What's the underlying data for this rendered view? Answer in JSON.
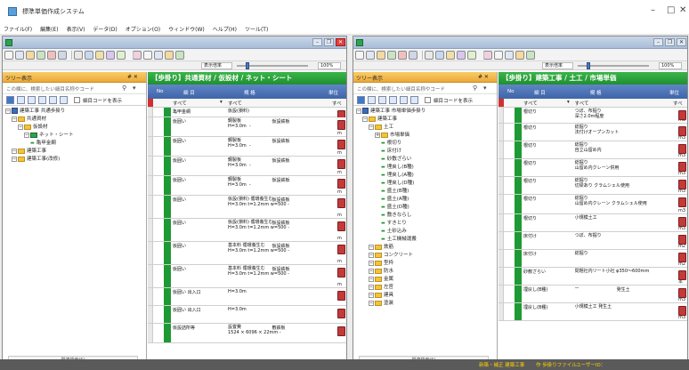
{
  "app": {
    "title": "標準単価作成システム"
  },
  "menu": [
    "ファイル(F)",
    "編集(E)",
    "表示(V)",
    "データ(D)",
    "オプション(O)",
    "ウィンドウ(W)",
    "ヘルプ(H)",
    "ツール(T)"
  ],
  "window_controls": {
    "minimize": "–",
    "maximize": "□",
    "close": "✕"
  },
  "panels": [
    {
      "zoom_label": "表示倍率",
      "zoom_value": "100%",
      "zoom_level_fraction": 0.6,
      "tree_title": "ツリー表示",
      "tree_ctl": "# ✕",
      "search_placeholder": "この欄に、検索したい細目名称やコード",
      "opt_label": "細目コードを表示",
      "tree": [
        {
          "level": 0,
          "label": "建築工事 共通歩掛り",
          "kind": "root"
        },
        {
          "level": 1,
          "label": "共通資材",
          "kind": "folder"
        },
        {
          "level": 2,
          "label": "仮設材",
          "kind": "folder"
        },
        {
          "level": 3,
          "label": "ネット・シート",
          "kind": "group"
        },
        {
          "level": 4,
          "label": "亀甲金網",
          "kind": "leaf"
        },
        {
          "level": 1,
          "label": "建築工事",
          "kind": "folder"
        },
        {
          "level": 1,
          "label": "建築工事(改修)",
          "kind": "folder"
        }
      ],
      "footer_label": "関連検索(S)",
      "header": "【歩掛り】共通資材 / 仮設材 / ネット・シート",
      "columns": {
        "no": "No",
        "name": "細 目",
        "spec": "規 格",
        "unit": "単位"
      },
      "filter": {
        "name": "すべて",
        "spec": "すべて",
        "unit": "すべ"
      },
      "rows": [
        {
          "name": "亀甲金網",
          "spec": "仮設(損料)",
          "spec2": "",
          "unit": ""
        },
        {
          "name": "仮囲い",
          "spec": "鋼製板",
          "spec2": "H=3.0m  -",
          "spec3": "仮設鉄板",
          "unit": "m"
        },
        {
          "name": "仮囲い",
          "spec": "鋼製板",
          "spec2": "H=3.0m  -",
          "spec3": "仮設鉄板",
          "unit": "m"
        },
        {
          "name": "仮囲い",
          "spec": "鋼製板",
          "spec2": "H=3.0m  -",
          "spec3": "仮設鉄板",
          "unit": "m"
        },
        {
          "name": "仮囲い",
          "spec": "鋼製板",
          "spec2": "H=3.0m  -",
          "spec3": "仮設鉄板",
          "unit": "m"
        },
        {
          "name": "仮囲い",
          "spec": "仮設(損料) 循環養生む",
          "spec2": "H=3.0m t=1.2mm w=500 -",
          "spec3": "仮設鉄板",
          "unit": "m"
        },
        {
          "name": "仮囲い",
          "spec": "仮設(損料) 循環養生む",
          "spec2": "H=3.0m t=1.2mm w=500 -",
          "spec3": "仮設鉄板",
          "unit": "m"
        },
        {
          "name": "仮囲い",
          "spec": "基本料 循環養生む",
          "spec2": "H=3.0m t=1.2mm w=500 -",
          "spec3": "仮設鉄板",
          "unit": "m"
        },
        {
          "name": "仮囲い",
          "spec": "基本料 循環養生む",
          "spec2": "H=3.0m t=1.2mm w=500 -",
          "spec3": "仮設鉄板",
          "unit": "m"
        },
        {
          "name": "仮囲い 出入口",
          "spec": "H=3.0m",
          "spec2": "",
          "spec3": "",
          "unit": ""
        },
        {
          "name": "仮囲い 出入口",
          "spec": "H=3.0m",
          "spec2": "",
          "spec3": "",
          "unit": ""
        },
        {
          "name": "仮設詰所等",
          "spec": "設置費",
          "spec2": "1524 × 6096 × 22mm -",
          "spec3": "敷鉄板",
          "unit": ""
        }
      ]
    },
    {
      "zoom_label": "表示倍率",
      "zoom_value": "100%",
      "zoom_level_fraction": 0.6,
      "tree_title": "ツリー表示",
      "tree_ctl": "# ✕",
      "search_placeholder": "この欄に、検索したい細目名称やコード",
      "opt_label": "細目コードを表示",
      "tree": [
        {
          "level": 0,
          "label": "建築工事 市場単価歩掛り",
          "kind": "root"
        },
        {
          "level": 1,
          "label": "建築工事",
          "kind": "folder"
        },
        {
          "level": 2,
          "label": "土工",
          "kind": "folder"
        },
        {
          "level": 3,
          "label": "市場単価",
          "kind": "folder"
        },
        {
          "level": 4,
          "label": "根切り",
          "kind": "leaf"
        },
        {
          "level": 4,
          "label": "床付け",
          "kind": "leaf"
        },
        {
          "level": 4,
          "label": "砂敷ざらい",
          "kind": "leaf"
        },
        {
          "level": 4,
          "label": "埋戻し(B種)",
          "kind": "leaf"
        },
        {
          "level": 4,
          "label": "埋戻し(A種)",
          "kind": "leaf"
        },
        {
          "level": 4,
          "label": "埋戻し(D種)",
          "kind": "leaf"
        },
        {
          "level": 4,
          "label": "盛土(B種)",
          "kind": "leaf"
        },
        {
          "level": 4,
          "label": "盛土(A種)",
          "kind": "leaf"
        },
        {
          "level": 4,
          "label": "盛土(D種)",
          "kind": "leaf"
        },
        {
          "level": 4,
          "label": "敷きならし",
          "kind": "leaf"
        },
        {
          "level": 4,
          "label": "すきとり",
          "kind": "leaf"
        },
        {
          "level": 4,
          "label": "土砂込み",
          "kind": "leaf"
        },
        {
          "level": 4,
          "label": "土工機械運搬",
          "kind": "leaf"
        },
        {
          "level": 2,
          "label": "鉄筋",
          "kind": "folder"
        },
        {
          "level": 2,
          "label": "コンクリート",
          "kind": "folder"
        },
        {
          "level": 2,
          "label": "型枠",
          "kind": "folder"
        },
        {
          "level": 2,
          "label": "防水",
          "kind": "folder"
        },
        {
          "level": 2,
          "label": "金属",
          "kind": "folder"
        },
        {
          "level": 2,
          "label": "左官",
          "kind": "folder"
        },
        {
          "level": 2,
          "label": "建具",
          "kind": "folder"
        },
        {
          "level": 2,
          "label": "塗装",
          "kind": "folder"
        }
      ],
      "footer_label": "関連検索(S)",
      "header": "【歩掛り】建築工事 / 土工 / 市場単価",
      "columns": {
        "no": "No",
        "name": "細 目",
        "spec": "規 格",
        "unit": "単位"
      },
      "filter": {
        "name": "すべて",
        "spec": "すべて",
        "unit": "すべ"
      },
      "rows": [
        {
          "name": "根切り",
          "spec": "つぼ、布掘り",
          "spec2": "深さ2.0m程度",
          "spec3": "",
          "unit": "m3"
        },
        {
          "name": "根切り",
          "spec": "総掘り",
          "spec2": "法付けオープンカット",
          "spec3": "",
          "unit": "m3"
        },
        {
          "name": "根切り",
          "spec": "総掘り",
          "spec2": "自立山留め内",
          "spec3": "",
          "unit": "m3"
        },
        {
          "name": "根切り",
          "spec": "総掘り",
          "spec2": "山留め内クレーン併用",
          "spec3": "",
          "unit": "m3"
        },
        {
          "name": "根切り",
          "spec": "総掘り",
          "spec2": "切梁あり クラムシェル使用",
          "spec3": "",
          "unit": "m3"
        },
        {
          "name": "根切り",
          "spec": "総掘り",
          "spec2": "山留め内クレーン クラムシェル使用",
          "spec3": "",
          "unit": "m3"
        },
        {
          "name": "根切り",
          "spec": "小規模土工",
          "spec2": "",
          "spec3": "",
          "unit": "m3"
        },
        {
          "name": "床付け",
          "spec": "つぼ、布掘り",
          "spec2": "",
          "spec3": "",
          "unit": "m2"
        },
        {
          "name": "床付け",
          "spec": "総掘り",
          "spec2": "",
          "spec3": "",
          "unit": "m2"
        },
        {
          "name": "砂敷ざらい",
          "spec": "問題社内リート小社 φ350〜600mm",
          "spec2": "",
          "spec3": "",
          "unit": "本"
        },
        {
          "name": "埋戻し(B種)",
          "spec": "ー",
          "spec2": "",
          "spec3": "発生土",
          "unit": "m3"
        },
        {
          "name": "埋戻し(B種)",
          "spec": "小規模土工 発生土",
          "spec2": "",
          "spec3": "",
          "unit": "m3"
        }
      ]
    }
  ],
  "status": {
    "segments": [
      "新築・補正 建築工事",
      "作 歩掛りファイル",
      "ユーザーID："
    ]
  }
}
